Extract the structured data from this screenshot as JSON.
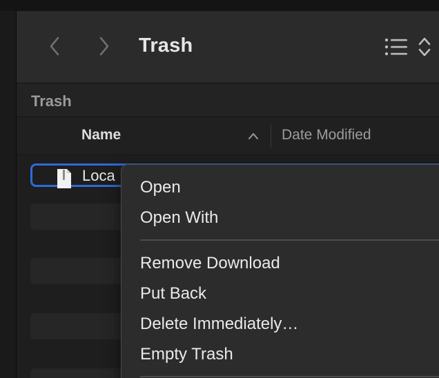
{
  "window": {
    "title": "Trash"
  },
  "toolbar": {
    "back_icon": "chevron-left-icon",
    "forward_icon": "chevron-right-icon",
    "view_icon": "list-view-icon",
    "view_menu_icon": "chevron-up-down-icon"
  },
  "pathbar": {
    "label": "Trash"
  },
  "columns": {
    "name": "Name",
    "date_modified": "Date Modified",
    "sort_icon": "chevron-up-icon"
  },
  "files": [
    {
      "name": "Loca",
      "icon": "document-icon",
      "selected": true
    }
  ],
  "context_menu": {
    "groups": [
      [
        "Open",
        "Open With"
      ],
      [
        "Remove Download",
        "Put Back",
        "Delete Immediately…",
        "Empty Trash"
      ]
    ]
  },
  "colors": {
    "selection": "#2f6bd8",
    "toolbar_bg": "#2b2b2b",
    "menu_bg": "#2c2c2c",
    "text": "#e8e8e8",
    "muted_text": "#9c9c9c"
  }
}
